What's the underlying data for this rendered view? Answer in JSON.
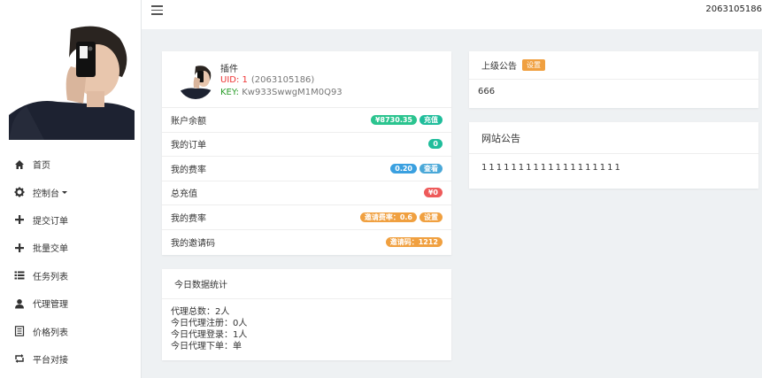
{
  "topbar": {
    "user_id": "2063105186"
  },
  "sidebar": {
    "items": [
      {
        "label": "首页",
        "icon": "home-icon"
      },
      {
        "label": "控制台",
        "icon": "gear-icon",
        "has_caret": true
      },
      {
        "label": "提交订单",
        "icon": "plus-icon"
      },
      {
        "label": "批量交单",
        "icon": "plus-icon"
      },
      {
        "label": "任务列表",
        "icon": "list-icon"
      },
      {
        "label": "代理管理",
        "icon": "user-icon"
      },
      {
        "label": "价格列表",
        "icon": "document-icon"
      },
      {
        "label": "平台对接",
        "icon": "retweet-icon"
      }
    ]
  },
  "profile": {
    "name": "插件",
    "uid_label": "UID: 1",
    "uid_paren": "(2063105186)",
    "key_label": "KEY:",
    "key_value": "Kw933SwwgM1M0Q93",
    "rows": [
      {
        "label": "账户余额",
        "badges": [
          {
            "text": "¥8730.35",
            "color": "green"
          },
          {
            "text": "充值",
            "color": "teal"
          }
        ]
      },
      {
        "label": "我的订单",
        "badges": [
          {
            "text": "0",
            "color": "teal"
          }
        ]
      },
      {
        "label": "我的费率",
        "badges": [
          {
            "text": "0.20",
            "color": "blue"
          },
          {
            "text": "查看",
            "color": "sky"
          }
        ]
      },
      {
        "label": "总充值",
        "badges": [
          {
            "text": "¥0",
            "color": "red"
          }
        ]
      },
      {
        "label": "我的费率",
        "badges": [
          {
            "text": "邀请费率：0.6",
            "color": "orange"
          },
          {
            "text": "设置",
            "color": "orange"
          }
        ]
      },
      {
        "label": "我的邀请码",
        "badges": [
          {
            "text": "邀请码：1212",
            "color": "orange"
          }
        ]
      }
    ]
  },
  "stats": {
    "title": "今日数据统计",
    "lines": [
      "代理总数：2人",
      "今日代理注册：0人",
      "今日代理登录：1人",
      "今日代理下单：单"
    ]
  },
  "notice_parent": {
    "title": "上级公告",
    "button": "设置",
    "content": "666"
  },
  "notice_site": {
    "title": "网站公告",
    "content": "1111111111111111111"
  },
  "colors": {
    "green": "#2bc48f",
    "teal": "#1fbd9b",
    "blue": "#3aa0e0",
    "red": "#ee5a5a",
    "orange": "#f0a040"
  }
}
